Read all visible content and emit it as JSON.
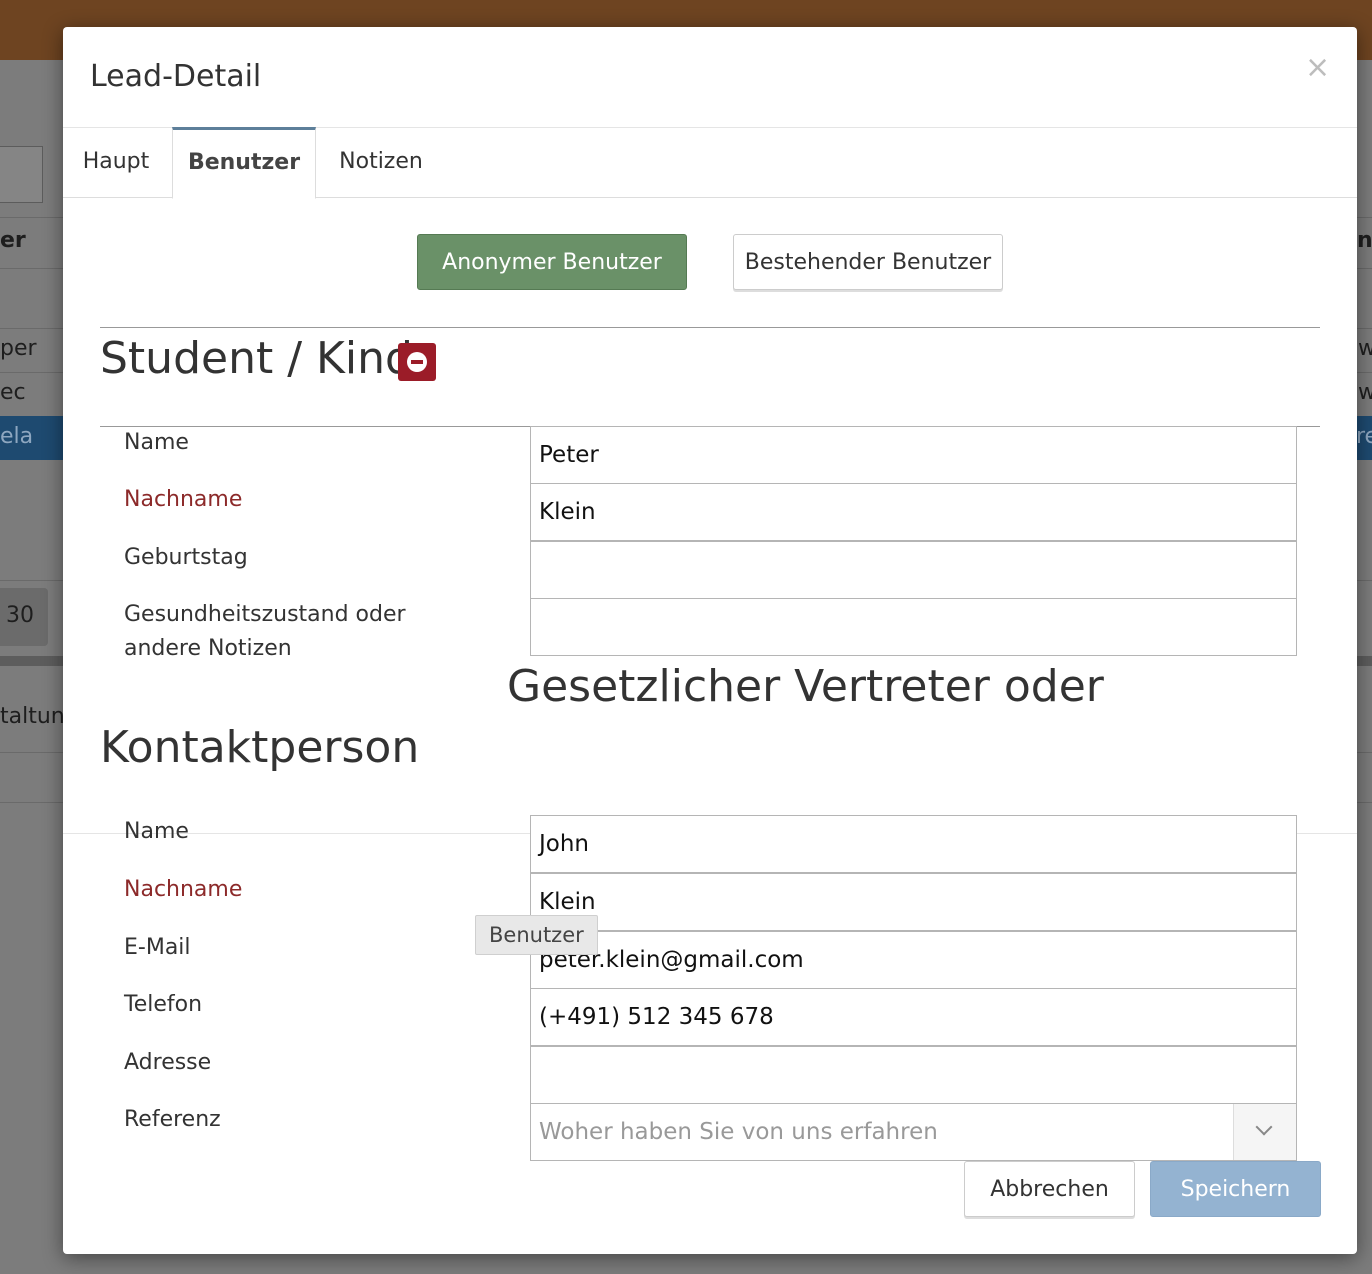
{
  "background": {
    "header_cell": "er",
    "right_header_cell": "n",
    "rows": [
      {
        "left": "per",
        "right": "w"
      },
      {
        "left": "ec",
        "right": "w"
      },
      {
        "left": "ela",
        "right": "re"
      }
    ],
    "page_number": "30",
    "footer_text": "taltun"
  },
  "modal": {
    "title": "Lead-Detail",
    "close_symbol": "×"
  },
  "tabs": [
    {
      "label": "Haupt",
      "active": false
    },
    {
      "label": "Benutzer",
      "active": true
    },
    {
      "label": "Notizen",
      "active": false
    }
  ],
  "user_type": {
    "anonymous_label": "Anonymer Benutzer",
    "existing_label": "Bestehender Benutzer"
  },
  "student": {
    "title": "Student / Kind",
    "fields": [
      {
        "label": "Name",
        "value": "Peter",
        "required": false
      },
      {
        "label": "Nachname",
        "value": "Klein",
        "required": true
      },
      {
        "label": "Geburtstag",
        "value": "",
        "required": false
      },
      {
        "label": "Gesundheitszustand oder andere Notizen",
        "value": "",
        "required": false
      }
    ]
  },
  "contact": {
    "title_line1": "Gesetzlicher Vertreter oder",
    "title_line2": "Kontaktperson",
    "fields": [
      {
        "label": "Name",
        "value": "John",
        "required": false
      },
      {
        "label": "Nachname",
        "value": "Klein",
        "required": true
      },
      {
        "label": "E-Mail",
        "value": "peter.klein@gmail.com",
        "required": false
      },
      {
        "label": "Telefon",
        "value": "(+491) 512 345 678",
        "required": false
      },
      {
        "label": "Adresse",
        "value": "",
        "required": false
      }
    ],
    "reference": {
      "label": "Referenz",
      "placeholder": "Woher haben Sie von uns erfahren"
    }
  },
  "tooltip": "Benutzer",
  "footer": {
    "cancel_label": "Abbrechen",
    "save_label": "Speichern"
  },
  "colors": {
    "anonymous_button": "#6a9168",
    "remove_button": "#9b1c28",
    "save_button": "#94b3d1",
    "required_label": "#8c2a2a"
  }
}
